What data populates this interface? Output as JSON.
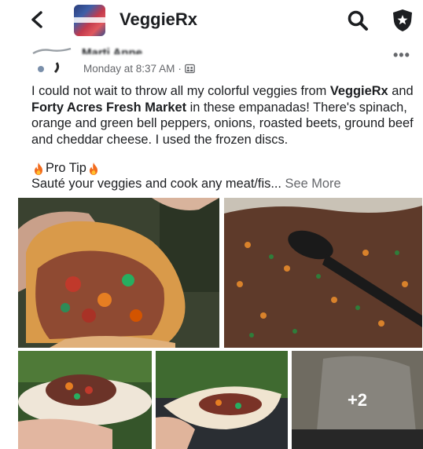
{
  "header": {
    "group_name": "VeggieRx",
    "icons": [
      "back-arrow-icon",
      "search-icon",
      "shield-icon"
    ]
  },
  "post": {
    "author": "Marti Anne",
    "timestamp": "Monday at 8:37 AM",
    "separator": "·",
    "visibility_icon": "group-members-icon",
    "more_label": "•••",
    "body": {
      "p1": "I could not wait to throw all my colorful veggies from ",
      "b1": "VeggieRx",
      "p2": " and ",
      "b2": "Forty Acres Fresh Market",
      "p3": " in these empanadas! There's spinach, orange and green bell peppers, onions, roasted beets, ground beef and cheddar cheese. I used the frozen discs."
    },
    "pro_tip": "Pro Tip",
    "preview": "Sauté your veggies and cook any meat/fis...",
    "see_more": "See More",
    "photos": {
      "more_count": "+2"
    }
  },
  "colors": {
    "text": "#1c1e21",
    "secondary": "#65676b",
    "flame": "#f26b1d"
  }
}
